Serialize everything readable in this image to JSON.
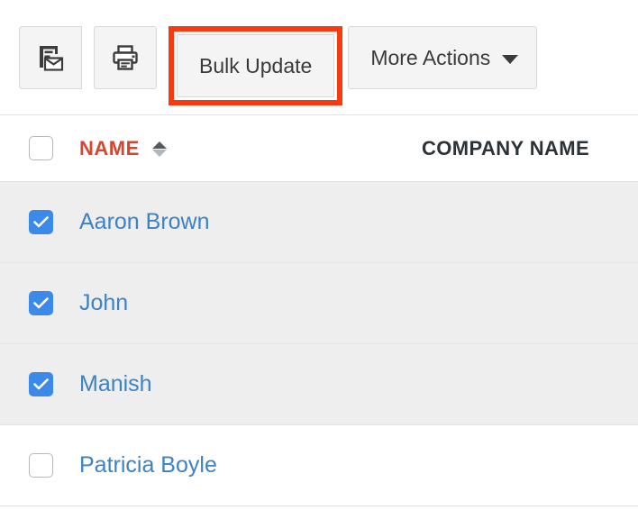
{
  "toolbar": {
    "buttons": [
      {
        "id": "mail-merge",
        "icon": "document-envelope-icon",
        "label": "",
        "highlighted": false
      },
      {
        "id": "print",
        "icon": "printer-icon",
        "label": "",
        "highlighted": false
      },
      {
        "id": "bulk-update",
        "icon": "",
        "label": "Bulk Update",
        "highlighted": true
      },
      {
        "id": "more-actions",
        "icon": "chevron-down-icon",
        "label": "More Actions",
        "highlighted": false
      }
    ],
    "highlight_color": "#f93a10"
  },
  "table": {
    "columns": [
      {
        "key": "name",
        "label": "NAME",
        "color": "#d8452e",
        "sorted": true,
        "sort_direction": "asc"
      },
      {
        "key": "company_name",
        "label": "COMPANY NAME",
        "color": "#2c3338",
        "sorted": false
      }
    ],
    "select_all_checked": false,
    "rows": [
      {
        "checked": true,
        "name": "Aaron Brown",
        "company_name": ""
      },
      {
        "checked": true,
        "name": "John",
        "company_name": ""
      },
      {
        "checked": true,
        "name": "Manish",
        "company_name": ""
      },
      {
        "checked": false,
        "name": "Patricia Boyle",
        "company_name": ""
      }
    ]
  },
  "colors": {
    "link": "#3d82c4",
    "checkbox_on": "#3b8aea",
    "selected_row_bg": "#eeeeee",
    "accent_red": "#d8452e",
    "highlight": "#f93a10"
  }
}
